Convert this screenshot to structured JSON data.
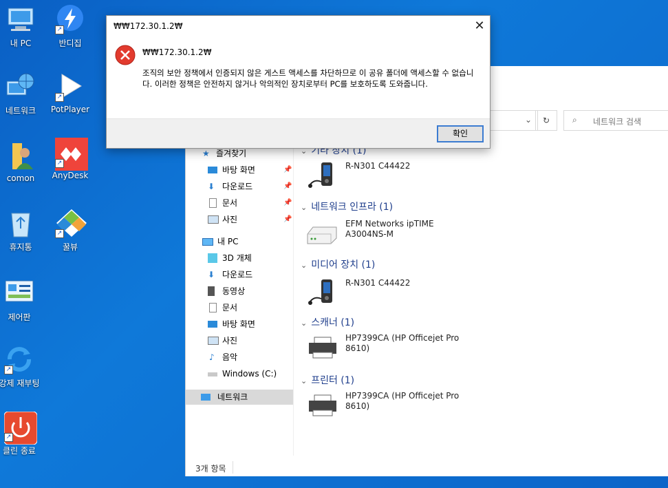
{
  "desktop": {
    "icons": [
      {
        "label": "내 PC",
        "icon": "computer-icon"
      },
      {
        "label": "반디집",
        "icon": "bandizip-icon"
      },
      {
        "label": "네트워크",
        "icon": "network-globe-icon"
      },
      {
        "label": "PotPlayer",
        "icon": "play-icon"
      },
      {
        "label": "comon",
        "icon": "user-folder-icon"
      },
      {
        "label": "AnyDesk",
        "icon": "anydesk-icon"
      },
      {
        "label": "휴지통",
        "icon": "recycle-bin-icon"
      },
      {
        "label": "꿀뷰",
        "icon": "honeyview-icon"
      },
      {
        "label": "제어판",
        "icon": "control-panel-icon"
      },
      {
        "label": "강제 재부팅",
        "icon": "reboot-icon"
      },
      {
        "label": "클린 종료",
        "icon": "power-icon"
      }
    ]
  },
  "explorer": {
    "search_placeholder": "네트워크 검색",
    "nav": {
      "quick_access": "즐겨찾기",
      "quick_items": [
        "바탕 화면",
        "다운로드",
        "문서",
        "사진"
      ],
      "this_pc": "내 PC",
      "pc_items": [
        "3D 개체",
        "다운로드",
        "동영상",
        "문서",
        "바탕 화면",
        "사진",
        "음악",
        "Windows (C:)"
      ],
      "network": "네트워크"
    },
    "groups": [
      {
        "title": "기타 장치 (1)",
        "items": [
          "R-N301 C44422"
        ]
      },
      {
        "title": "네트워크 인프라 (1)",
        "items": [
          "EFM Networks ipTIME A3004NS-M"
        ]
      },
      {
        "title": "미디어 장치 (1)",
        "items": [
          "R-N301 C44422"
        ]
      },
      {
        "title": "스캐너 (1)",
        "items": [
          "HP7399CA (HP Officejet Pro 8610)"
        ]
      },
      {
        "title": "프린터 (1)",
        "items": [
          "HP7399CA (HP Officejet Pro 8610)"
        ]
      }
    ],
    "status": "3개 항목"
  },
  "dialog": {
    "title": "₩₩172.30.1.2₩",
    "heading": "₩₩172.30.1.2₩",
    "message": "조직의 보안 정책에서 인증되지 않은 게스트 액세스를 차단하므로 이 공유 폴더에 액세스할 수 없습니다. 이러한 정책은 안전하지 않거나 악의적인 장치로부터 PC를 보호하도록 도와줍니다.",
    "ok_label": "확인",
    "close_glyph": "✕"
  }
}
